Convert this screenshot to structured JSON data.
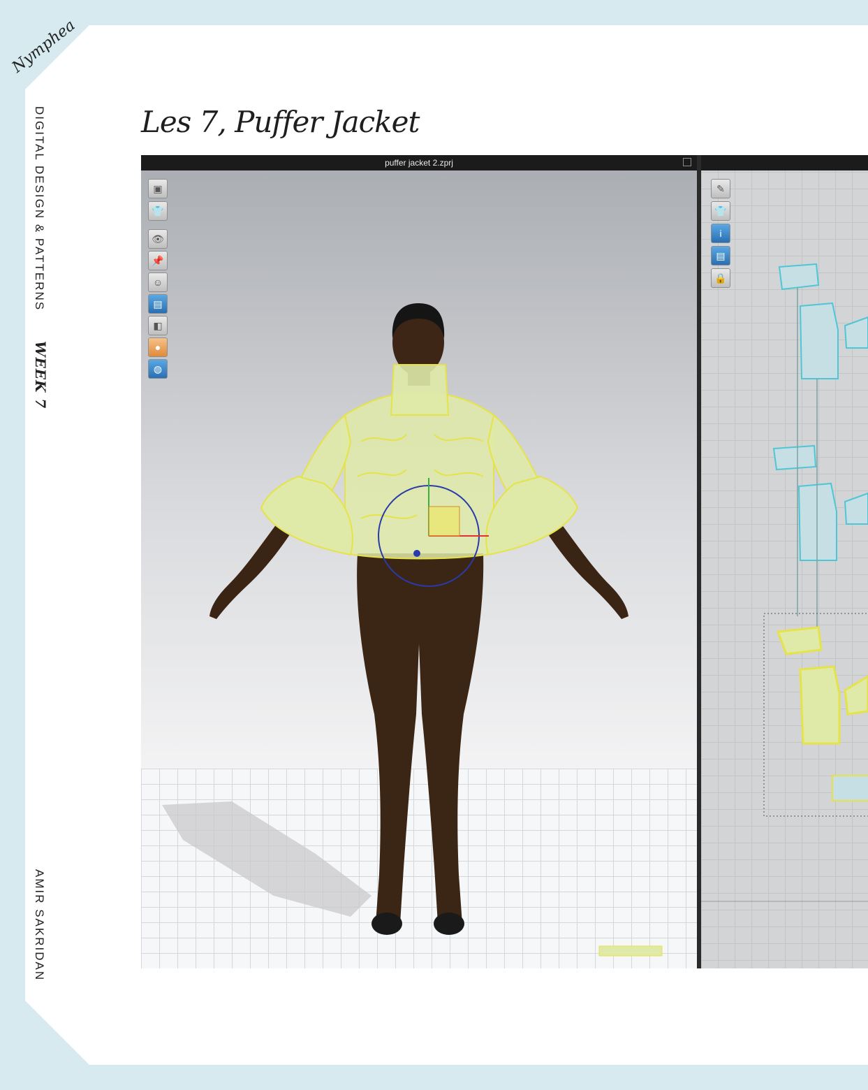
{
  "branding": {
    "logo_text": "Nymphea"
  },
  "sidebar": {
    "section_title": "DIGITAL DESIGN & PATTERNS",
    "week_label": "WEEK 7",
    "author": "AMIR SAKRIDAN"
  },
  "page": {
    "title": "Les 7, Puffer Jacket"
  },
  "viewport_3d": {
    "file_title": "puffer jacket 2.zprj",
    "toolbar_icons": [
      "render-icon",
      "garment-icon",
      "show-garment-icon",
      "show-pins-icon",
      "show-avatar-icon",
      "fabric-icon",
      "texture-icon",
      "avatar-icon",
      "environment-icon"
    ]
  },
  "pattern_2d": {
    "toolbar_icons": [
      "pen-icon",
      "garment-icon",
      "info-icon",
      "texture-icon",
      "lock-icon"
    ]
  },
  "colors": {
    "background": "#d6eaef",
    "garment": "#dfeaa8",
    "garment_outline": "#e6e34a",
    "pattern_outline": "#4fc6d6",
    "gizmo_x": "#e03030",
    "gizmo_y": "#38b040",
    "gizmo_z": "#2a3aa8"
  }
}
